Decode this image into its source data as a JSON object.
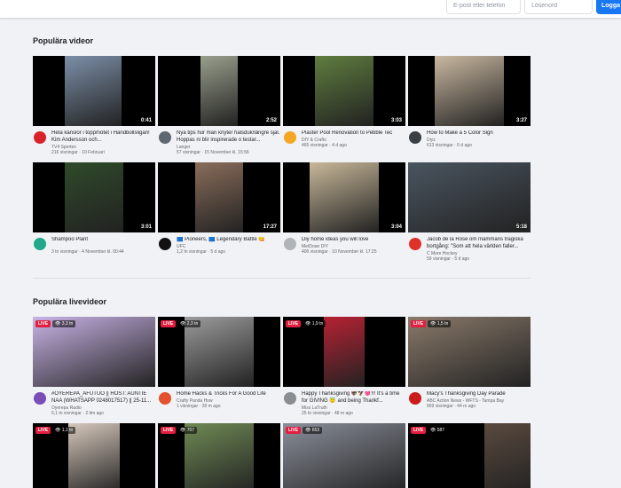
{
  "login": {
    "email_placeholder": "E-post eller telefon",
    "password_placeholder": "Lösenord",
    "button_label": "Logga in"
  },
  "sections": {
    "popular_videos": "Populära videor",
    "popular_live": "Populära livevideor"
  },
  "videos": [
    {
      "title": "Heta känslor i toppmötet i Handbollsligan! Kim Andersson och...",
      "channel": "TV4 Sporten",
      "stats": "216 visningar · 10 Februari",
      "duration": "0:41",
      "avatar_color": "#d8232a",
      "thumb_color": "#7c8fa8"
    },
    {
      "title": "Nya tips hur man knyter halsduk/långre sjal. Hoppas ni blir inspirerade o testar...",
      "channel": "Langer",
      "stats": "57 visningar · 15 November kl. 15:56",
      "duration": "2:52",
      "avatar_color": "#5f6770",
      "thumb_color": "#9a9f8c"
    },
    {
      "title": "Plaster Pool Renovation to Pebble Tec",
      "channel": "DIY & Crafts",
      "stats": "465 visningar · 4 d ago",
      "duration": "3:03",
      "avatar_color": "#f5a623",
      "thumb_color": "#5f7d3f"
    },
    {
      "title": "How to Make a 5 Color Sign",
      "channel": "Diyz",
      "stats": "613 visningar · 6 d ago",
      "duration": "3:27",
      "avatar_color": "#3a3f46",
      "thumb_color": "#c9b8a0"
    },
    {
      "title": "Shampoo Plant",
      "channel": "",
      "stats": "3 tn visningar · 4 November kl. 00:44",
      "duration": "3:01",
      "avatar_color": "#1fa889",
      "thumb_color": "#2f4a2a"
    },
    {
      "title": "🟦 Pioneers, 🟦 Legendary Battle 😋",
      "channel": "UFC",
      "stats": "1,2 tn visningar · 5 d ago",
      "duration": "17:27",
      "avatar_color": "#111111",
      "thumb_color": "#8a6d5a"
    },
    {
      "title": "Diy home ideas you will love",
      "channel": "MetDoan DIY",
      "stats": "406 visningar · 10 November kl. 17:25",
      "duration": "3:04",
      "avatar_color": "#b0b3b8",
      "thumb_color": "#c8b89a"
    },
    {
      "title": "Jacob de la Rose om mammans tragiska bortgång: \"Som att hela världen faller...",
      "channel": "C More Hockey",
      "stats": "59 visningar · 5 d ago",
      "duration": "5:18",
      "avatar_color": "#e0302a",
      "thumb_color": "#4a5560"
    }
  ],
  "live": [
    {
      "title": "#OYEREPA_AFUTUO || HOST: AUNTIE NAA (WHATSAPP 0248017517) || 25-11...",
      "channel": "Oyerepa Radio",
      "stats": "6,1 tn visningar · 2 tim ago",
      "viewers": "3,3 tn",
      "avatar_color": "#7b4db8",
      "thumb_color": "#c9b3e6"
    },
    {
      "title": "Home Hacks & Tricks For A Good Life",
      "channel": "Crafty Panda How",
      "stats": "1 visningar · 28 m ago",
      "viewers": "2,3 tn",
      "avatar_color": "#e4512e",
      "thumb_color": "#9c9c9c"
    },
    {
      "title": "Happy Thanksgiving 🦃🦅💓!!! It's a time for GIVING 😇 and being Thankf...",
      "channel": "Miss LaTruth",
      "stats": "25 tn visningar · 48 m ago",
      "viewers": "1,9 tn",
      "avatar_color": "#8a8d91",
      "thumb_color": "#b72233"
    },
    {
      "title": "Macy's Thanksgiving Day Parade",
      "channel": "ABC Action News - WFTS - Tampa Bay",
      "stats": "669 visningar · 44 m ago",
      "viewers": "1,5 tn",
      "avatar_color": "#cc1b1b",
      "thumb_color": "#8a7a6a"
    },
    {
      "viewers": "1,1 tn",
      "thumb_color": "#d7c9bc"
    },
    {
      "viewers": "707",
      "thumb_color": "#6f8a55"
    },
    {
      "viewers": "653",
      "thumb_color": "#8a8f9a"
    },
    {
      "viewers": "587",
      "thumb_color": "#5a4a3f"
    }
  ],
  "live_badge": "LIVE",
  "eye_glyph": "👁"
}
